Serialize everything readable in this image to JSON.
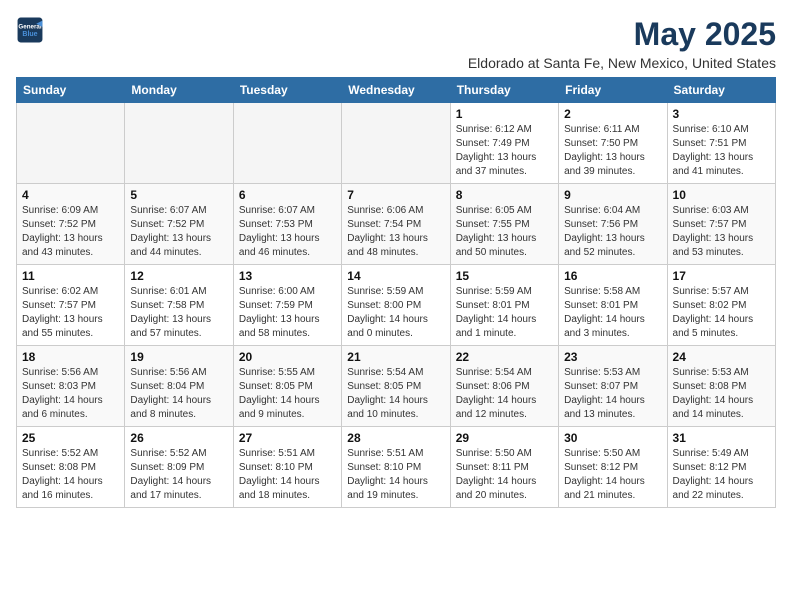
{
  "logo": {
    "line1": "General",
    "line2": "Blue"
  },
  "title": "May 2025",
  "subtitle": "Eldorado at Santa Fe, New Mexico, United States",
  "headers": [
    "Sunday",
    "Monday",
    "Tuesday",
    "Wednesday",
    "Thursday",
    "Friday",
    "Saturday"
  ],
  "weeks": [
    [
      {
        "day": "",
        "info": ""
      },
      {
        "day": "",
        "info": ""
      },
      {
        "day": "",
        "info": ""
      },
      {
        "day": "",
        "info": ""
      },
      {
        "day": "1",
        "info": "Sunrise: 6:12 AM\nSunset: 7:49 PM\nDaylight: 13 hours\nand 37 minutes."
      },
      {
        "day": "2",
        "info": "Sunrise: 6:11 AM\nSunset: 7:50 PM\nDaylight: 13 hours\nand 39 minutes."
      },
      {
        "day": "3",
        "info": "Sunrise: 6:10 AM\nSunset: 7:51 PM\nDaylight: 13 hours\nand 41 minutes."
      }
    ],
    [
      {
        "day": "4",
        "info": "Sunrise: 6:09 AM\nSunset: 7:52 PM\nDaylight: 13 hours\nand 43 minutes."
      },
      {
        "day": "5",
        "info": "Sunrise: 6:07 AM\nSunset: 7:52 PM\nDaylight: 13 hours\nand 44 minutes."
      },
      {
        "day": "6",
        "info": "Sunrise: 6:07 AM\nSunset: 7:53 PM\nDaylight: 13 hours\nand 46 minutes."
      },
      {
        "day": "7",
        "info": "Sunrise: 6:06 AM\nSunset: 7:54 PM\nDaylight: 13 hours\nand 48 minutes."
      },
      {
        "day": "8",
        "info": "Sunrise: 6:05 AM\nSunset: 7:55 PM\nDaylight: 13 hours\nand 50 minutes."
      },
      {
        "day": "9",
        "info": "Sunrise: 6:04 AM\nSunset: 7:56 PM\nDaylight: 13 hours\nand 52 minutes."
      },
      {
        "day": "10",
        "info": "Sunrise: 6:03 AM\nSunset: 7:57 PM\nDaylight: 13 hours\nand 53 minutes."
      }
    ],
    [
      {
        "day": "11",
        "info": "Sunrise: 6:02 AM\nSunset: 7:57 PM\nDaylight: 13 hours\nand 55 minutes."
      },
      {
        "day": "12",
        "info": "Sunrise: 6:01 AM\nSunset: 7:58 PM\nDaylight: 13 hours\nand 57 minutes."
      },
      {
        "day": "13",
        "info": "Sunrise: 6:00 AM\nSunset: 7:59 PM\nDaylight: 13 hours\nand 58 minutes."
      },
      {
        "day": "14",
        "info": "Sunrise: 5:59 AM\nSunset: 8:00 PM\nDaylight: 14 hours\nand 0 minutes."
      },
      {
        "day": "15",
        "info": "Sunrise: 5:59 AM\nSunset: 8:01 PM\nDaylight: 14 hours\nand 1 minute."
      },
      {
        "day": "16",
        "info": "Sunrise: 5:58 AM\nSunset: 8:01 PM\nDaylight: 14 hours\nand 3 minutes."
      },
      {
        "day": "17",
        "info": "Sunrise: 5:57 AM\nSunset: 8:02 PM\nDaylight: 14 hours\nand 5 minutes."
      }
    ],
    [
      {
        "day": "18",
        "info": "Sunrise: 5:56 AM\nSunset: 8:03 PM\nDaylight: 14 hours\nand 6 minutes."
      },
      {
        "day": "19",
        "info": "Sunrise: 5:56 AM\nSunset: 8:04 PM\nDaylight: 14 hours\nand 8 minutes."
      },
      {
        "day": "20",
        "info": "Sunrise: 5:55 AM\nSunset: 8:05 PM\nDaylight: 14 hours\nand 9 minutes."
      },
      {
        "day": "21",
        "info": "Sunrise: 5:54 AM\nSunset: 8:05 PM\nDaylight: 14 hours\nand 10 minutes."
      },
      {
        "day": "22",
        "info": "Sunrise: 5:54 AM\nSunset: 8:06 PM\nDaylight: 14 hours\nand 12 minutes."
      },
      {
        "day": "23",
        "info": "Sunrise: 5:53 AM\nSunset: 8:07 PM\nDaylight: 14 hours\nand 13 minutes."
      },
      {
        "day": "24",
        "info": "Sunrise: 5:53 AM\nSunset: 8:08 PM\nDaylight: 14 hours\nand 14 minutes."
      }
    ],
    [
      {
        "day": "25",
        "info": "Sunrise: 5:52 AM\nSunset: 8:08 PM\nDaylight: 14 hours\nand 16 minutes."
      },
      {
        "day": "26",
        "info": "Sunrise: 5:52 AM\nSunset: 8:09 PM\nDaylight: 14 hours\nand 17 minutes."
      },
      {
        "day": "27",
        "info": "Sunrise: 5:51 AM\nSunset: 8:10 PM\nDaylight: 14 hours\nand 18 minutes."
      },
      {
        "day": "28",
        "info": "Sunrise: 5:51 AM\nSunset: 8:10 PM\nDaylight: 14 hours\nand 19 minutes."
      },
      {
        "day": "29",
        "info": "Sunrise: 5:50 AM\nSunset: 8:11 PM\nDaylight: 14 hours\nand 20 minutes."
      },
      {
        "day": "30",
        "info": "Sunrise: 5:50 AM\nSunset: 8:12 PM\nDaylight: 14 hours\nand 21 minutes."
      },
      {
        "day": "31",
        "info": "Sunrise: 5:49 AM\nSunset: 8:12 PM\nDaylight: 14 hours\nand 22 minutes."
      }
    ]
  ]
}
